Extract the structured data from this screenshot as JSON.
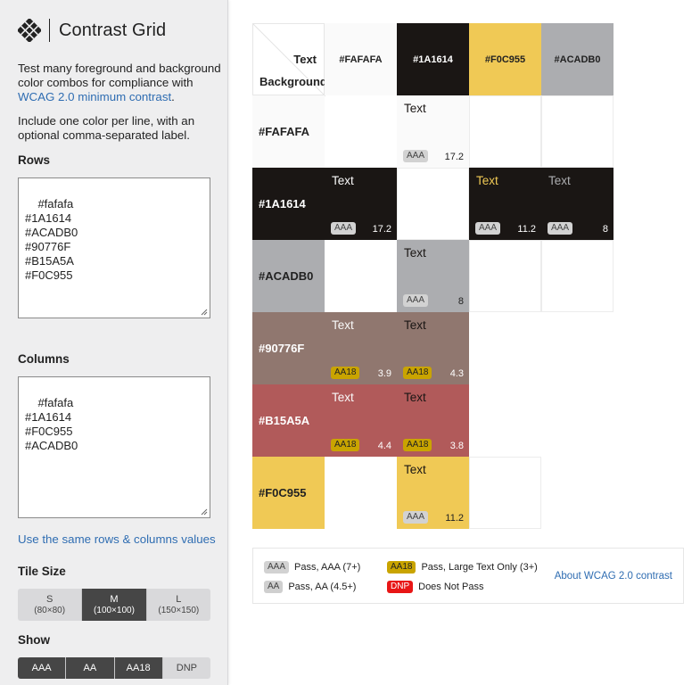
{
  "app": {
    "title": "Contrast Grid",
    "intro_prefix": "Test many foreground and background color combos for compliance with ",
    "intro_link": "WCAG 2.0 minimum contrast",
    "intro_suffix": ".",
    "intro2": "Include one color per line, with an optional comma-separated label."
  },
  "rows": {
    "label": "Rows",
    "value": "#fafafa\n#1A1614\n#ACADB0\n#90776F\n#B15A5A\n#F0C955"
  },
  "columns": {
    "label": "Columns",
    "value": "#fafafa\n#1A1614\n#F0C955\n#ACADB0"
  },
  "same_values_link": "Use the same rows & columns values",
  "tile_size": {
    "label": "Tile Size",
    "options": [
      {
        "label": "S",
        "sub": "(80×80)",
        "active": false
      },
      {
        "label": "M",
        "sub": "(100×100)",
        "active": true
      },
      {
        "label": "L",
        "sub": "(150×150)",
        "active": false
      }
    ]
  },
  "show": {
    "label": "Show",
    "options": [
      {
        "label": "AAA",
        "active": true
      },
      {
        "label": "AA",
        "active": true
      },
      {
        "label": "AA18",
        "active": true
      },
      {
        "label": "DNP",
        "active": false
      }
    ]
  },
  "grid": {
    "corner_text": "Text",
    "corner_background": "Background",
    "columns": [
      {
        "label": "#FAFAFA",
        "color": "#FAFAFA",
        "fg": "#222222"
      },
      {
        "label": "#1A1614",
        "color": "#1A1614",
        "fg": "#ffffff"
      },
      {
        "label": "#F0C955",
        "color": "#F0C955",
        "fg": "#222222"
      },
      {
        "label": "#ACADB0",
        "color": "#ACADB0",
        "fg": "#222222"
      }
    ],
    "rows": [
      {
        "label": "#FAFAFA",
        "color": "#FAFAFA",
        "fg": "#222222",
        "tiles": [
          null,
          {
            "text": "Text",
            "badge": "AAA",
            "ratio": "17.2"
          },
          null,
          null
        ]
      },
      {
        "label": "#1A1614",
        "color": "#1A1614",
        "fg": "#ffffff",
        "tiles": [
          {
            "text": "Text",
            "badge": "AAA",
            "ratio": "17.2"
          },
          null,
          {
            "text": "Text",
            "badge": "AAA",
            "ratio": "11.2"
          },
          {
            "text": "Text",
            "badge": "AAA",
            "ratio": "8"
          }
        ]
      },
      {
        "label": "#ACADB0",
        "color": "#ACADB0",
        "fg": "#222222",
        "tiles": [
          null,
          {
            "text": "Text",
            "badge": "AAA",
            "ratio": "8"
          },
          null,
          null
        ]
      },
      {
        "label": "#90776F",
        "color": "#90776F",
        "fg": "#ffffff",
        "tiles": [
          {
            "text": "Text",
            "badge": "AA18",
            "ratio": "3.9"
          },
          {
            "text": "Text",
            "badge": "AA18",
            "ratio": "4.3"
          },
          null,
          null
        ]
      },
      {
        "label": "#B15A5A",
        "color": "#B15A5A",
        "fg": "#ffffff",
        "tiles": [
          {
            "text": "Text",
            "badge": "AA18",
            "ratio": "4.4"
          },
          {
            "text": "Text",
            "badge": "AA18",
            "ratio": "3.8"
          },
          null,
          null
        ]
      },
      {
        "label": "#F0C955",
        "color": "#F0C955",
        "fg": "#222222",
        "tiles": [
          null,
          {
            "text": "Text",
            "badge": "AAA",
            "ratio": "11.2"
          },
          null,
          null
        ]
      }
    ],
    "empty_cells_bordered": [
      [
        0,
        2
      ],
      [
        0,
        3
      ],
      [
        1,
        1
      ],
      [
        2,
        2
      ],
      [
        2,
        3
      ],
      [
        5,
        2
      ]
    ]
  },
  "legend": {
    "items": [
      {
        "badge": "AAA",
        "text": "Pass, AAA (7+)",
        "kind": "aaa"
      },
      {
        "badge": "AA",
        "text": "Pass, AA (4.5+)",
        "kind": "aa"
      },
      {
        "badge": "AA18",
        "text": "Pass, Large Text Only (3+)",
        "kind": "aa18"
      },
      {
        "badge": "DNP",
        "text": "Does Not Pass",
        "kind": "dnp"
      }
    ],
    "link": "About WCAG 2.0 contrast"
  }
}
